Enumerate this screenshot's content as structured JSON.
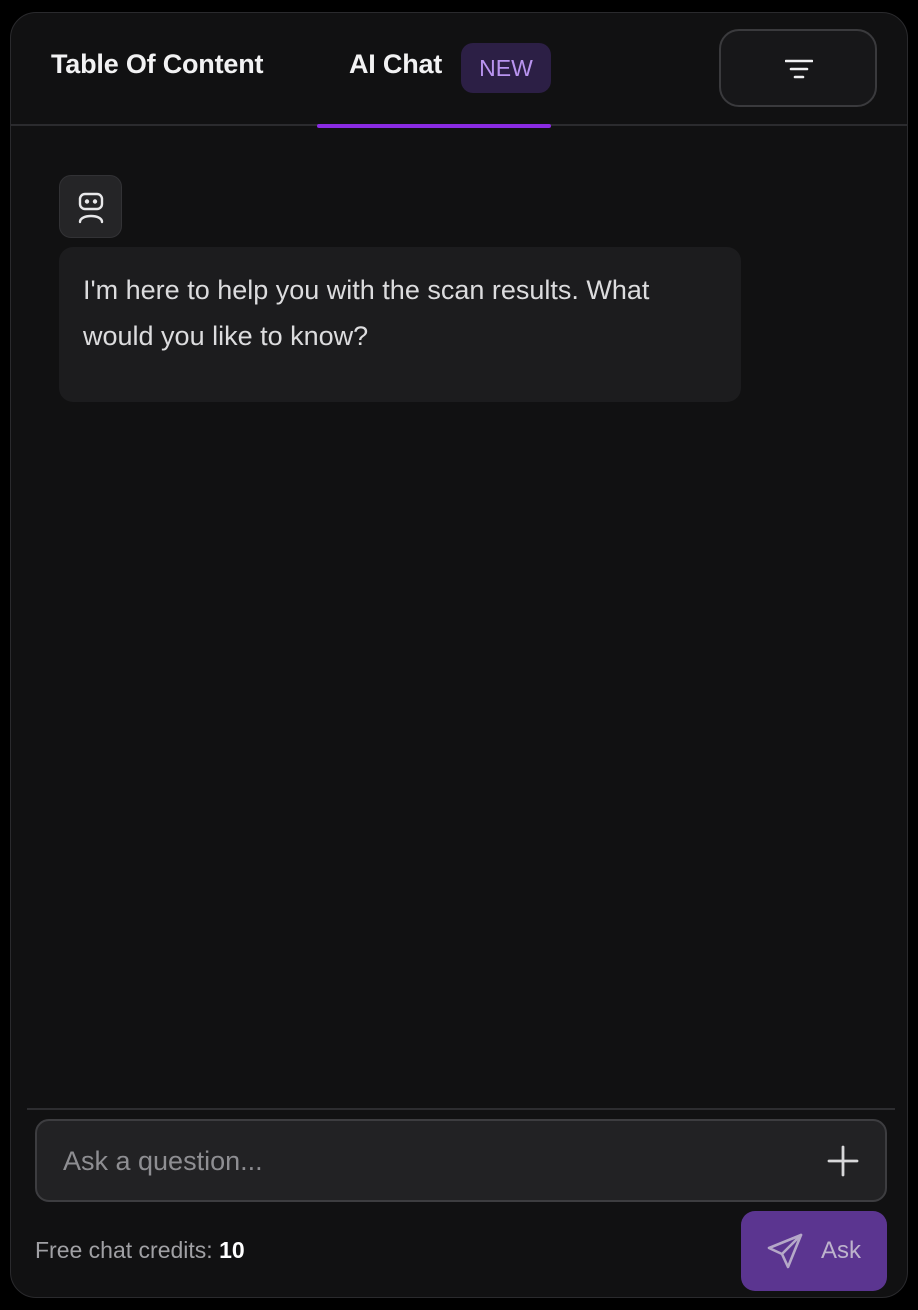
{
  "tabs": {
    "toc_label": "Table Of Content",
    "ai_chat_label": "AI Chat",
    "new_badge": "NEW"
  },
  "filter_button": {
    "icon": "filter-lines-icon"
  },
  "messages": [
    {
      "sender_icon": "robot-icon",
      "text": "I'm here to help you with the scan results. What would you like to know?"
    }
  ],
  "composer": {
    "placeholder": "Ask a question...",
    "value": "",
    "attach_icon": "plus-icon"
  },
  "footer": {
    "credits_label": "Free chat credits:",
    "credits_value": "10",
    "ask_label": "Ask",
    "ask_icon": "send-icon"
  },
  "colors": {
    "accent": "#8a2be2",
    "badge_bg": "#2c1f45",
    "badge_text": "#b994f0",
    "ask_button_bg": "#5b3590",
    "panel_bg": "#111112"
  }
}
